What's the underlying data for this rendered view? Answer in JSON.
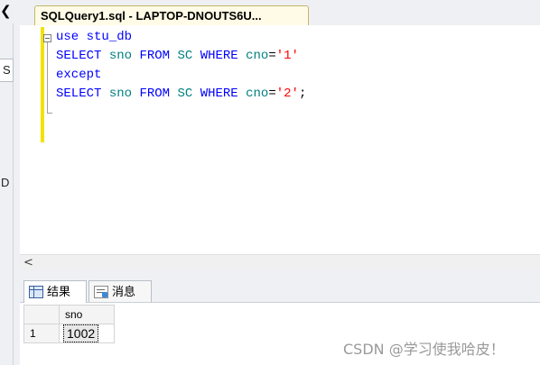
{
  "left_panel": {
    "collapse_glyph": "❮",
    "letter_s": "S",
    "letter_d": "D"
  },
  "editor_tab": {
    "title": "SQLQuery1.sql - LAPTOP-DNOUTS6U..."
  },
  "code_lines": [
    [
      {
        "t": "use",
        "c": "kw"
      },
      {
        "t": " ",
        "c": ""
      },
      {
        "t": "stu_db",
        "c": "kw"
      }
    ],
    [
      {
        "t": "SELECT",
        "c": "kw"
      },
      {
        "t": " ",
        "c": ""
      },
      {
        "t": "sno",
        "c": "id"
      },
      {
        "t": " ",
        "c": ""
      },
      {
        "t": "FROM",
        "c": "kw"
      },
      {
        "t": " ",
        "c": ""
      },
      {
        "t": "SC",
        "c": "id"
      },
      {
        "t": " ",
        "c": ""
      },
      {
        "t": "WHERE",
        "c": "kw"
      },
      {
        "t": " ",
        "c": ""
      },
      {
        "t": "cno",
        "c": "id"
      },
      {
        "t": "=",
        "c": ""
      },
      {
        "t": "'1'",
        "c": "str"
      }
    ],
    [
      {
        "t": "except",
        "c": "kw"
      }
    ],
    [
      {
        "t": "SELECT",
        "c": "kw"
      },
      {
        "t": " ",
        "c": ""
      },
      {
        "t": "sno",
        "c": "id"
      },
      {
        "t": " ",
        "c": ""
      },
      {
        "t": "FROM",
        "c": "kw"
      },
      {
        "t": " ",
        "c": ""
      },
      {
        "t": "SC",
        "c": "id"
      },
      {
        "t": " ",
        "c": ""
      },
      {
        "t": "WHERE",
        "c": "kw"
      },
      {
        "t": " ",
        "c": ""
      },
      {
        "t": "cno",
        "c": "id"
      },
      {
        "t": "=",
        "c": ""
      },
      {
        "t": "'2'",
        "c": "str"
      },
      {
        "t": ";",
        "c": ""
      }
    ]
  ],
  "scroll": {
    "left_arrow": "<"
  },
  "results_tabs": {
    "results_label": "结果",
    "messages_label": "消息"
  },
  "results_grid": {
    "columns": [
      "sno"
    ],
    "rows": [
      {
        "row_number": "1",
        "sno": "1002"
      }
    ]
  },
  "watermark": "CSDN @学习使我哈皮！",
  "colors": {
    "keyword": "#0000ff",
    "identifier": "#008080",
    "string": "#ff0000",
    "change_bar": "#f2e200"
  }
}
